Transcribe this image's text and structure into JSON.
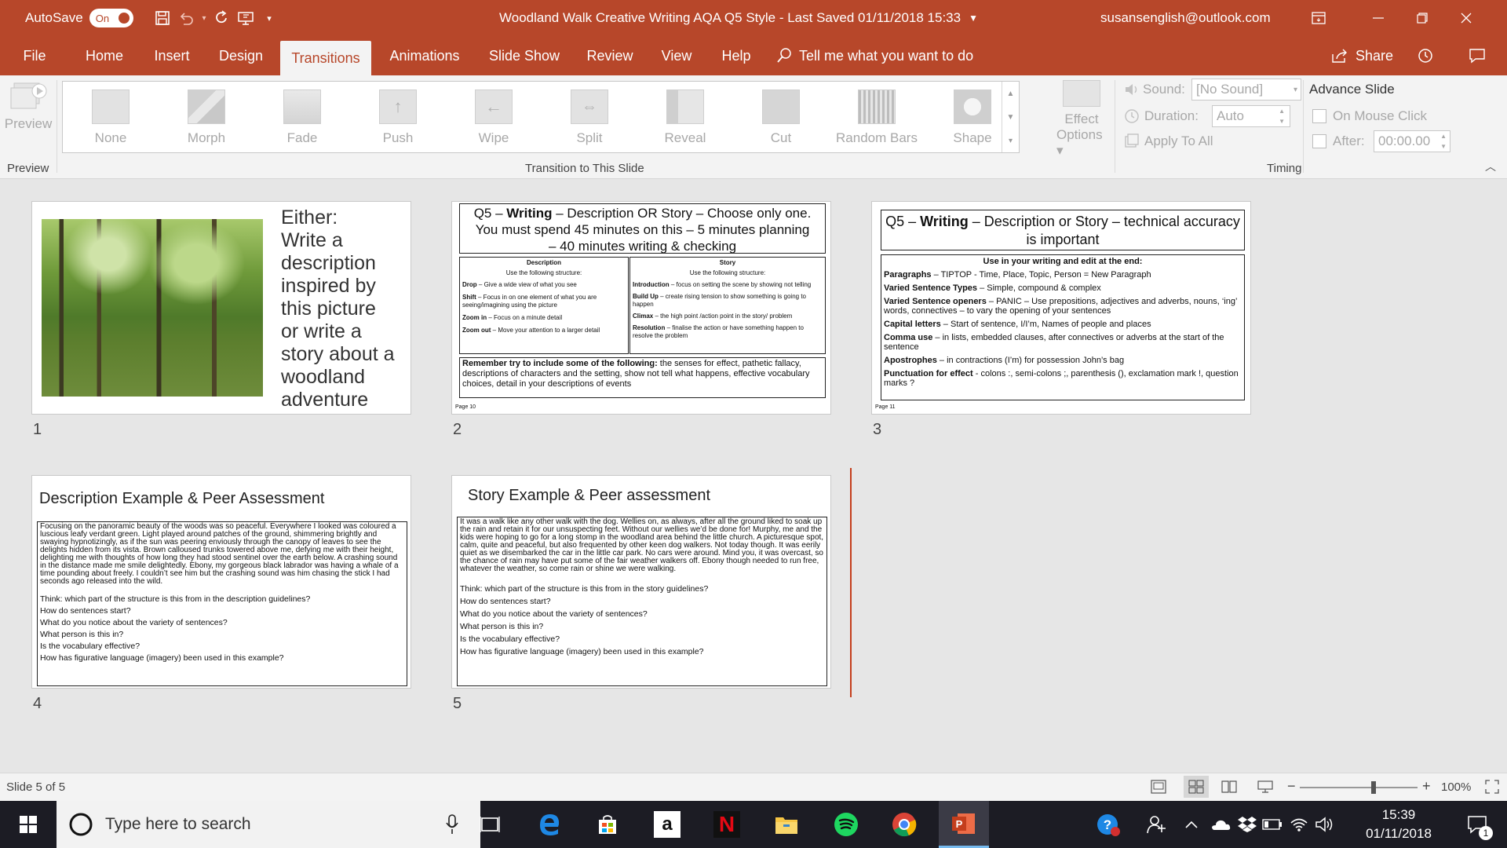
{
  "titlebar": {
    "autosave_label": "AutoSave",
    "autosave_state": "On",
    "document_title": "Woodland Walk Creative Writing AQA Q5 Style  -  Last Saved 01/11/2018 15:33",
    "account": "susansenglish@outlook.com"
  },
  "tabs": [
    {
      "label": "File"
    },
    {
      "label": "Home"
    },
    {
      "label": "Insert"
    },
    {
      "label": "Design"
    },
    {
      "label": "Transitions",
      "active": true
    },
    {
      "label": "Animations"
    },
    {
      "label": "Slide Show"
    },
    {
      "label": "Review"
    },
    {
      "label": "View"
    },
    {
      "label": "Help"
    }
  ],
  "tell_me": "Tell me what you want to do",
  "share_label": "Share",
  "ribbon": {
    "preview_label": "Preview",
    "preview_group": "Preview",
    "transitions": [
      "None",
      "Morph",
      "Fade",
      "Push",
      "Wipe",
      "Split",
      "Reveal",
      "Cut",
      "Random Bars",
      "Shape"
    ],
    "effect_options_line1": "Effect",
    "effect_options_line2": "Options",
    "transition_group": "Transition to This Slide",
    "sound_label": "Sound:",
    "sound_value": "[No Sound]",
    "duration_label": "Duration:",
    "duration_value": "Auto",
    "apply_all": "Apply To All",
    "advance_label": "Advance Slide",
    "on_mouse_click": "On Mouse Click",
    "after_label": "After:",
    "after_value": "00:00.00",
    "timing_group": "Timing"
  },
  "slides": {
    "s1": {
      "number": "1",
      "text_lines": [
        "Either:",
        "Write a",
        "description",
        "inspired by",
        "this picture",
        "or  write a",
        "story about a",
        "woodland",
        "adventure"
      ]
    },
    "s2": {
      "number": "2",
      "header_line1_prefix": "Q5 – ",
      "header_bold": "Writing",
      "header_line1_suffix": " – Description OR Story – Choose only one.",
      "header_line2": "You must spend 45 minutes on this – 5 minutes planning",
      "header_line3": "– 40 minutes writing & checking",
      "desc_title": "Description",
      "desc_sub": "Use the following structure:",
      "desc_items": [
        {
          "bold": "Drop",
          "text": " – Give a wide view of what you see"
        },
        {
          "bold": "Shift",
          "text": " – Focus in on one element of what you are seeing/imagining using the picture"
        },
        {
          "bold": "Zoom in",
          "text": " – Focus on a minute detail"
        },
        {
          "bold": "Zoom out",
          "text": " – Move your attention to a larger detail"
        }
      ],
      "story_title": "Story",
      "story_sub": "Use the following structure:",
      "story_items": [
        {
          "bold": "Introduction",
          "text": " – focus on setting the scene by showing not telling"
        },
        {
          "bold": "Build Up",
          "text": " – create rising tension to show something is going to happen"
        },
        {
          "bold": "Climax",
          "text": " – the high point /action point in the story/ problem"
        },
        {
          "bold": "Resolution",
          "text": " – finalise the action or have something happen to resolve the problem"
        }
      ],
      "remember_bold": "Remember try to include some of the following:",
      "remember_text": " the senses for effect, pathetic fallacy, descriptions of characters and the setting, show not tell what happens, effective vocabulary choices, detail in your descriptions of events",
      "page_label": "Page 10"
    },
    "s3": {
      "number": "3",
      "header_prefix": "Q5 – ",
      "header_bold": "Writing",
      "header_suffix": " – Description or Story – technical accuracy is important",
      "use_line": "Use in your writing and edit at the end:",
      "items": [
        {
          "bold": "Paragraphs",
          "text": " – TIPTOP - Time, Place, Topic, Person = New Paragraph"
        },
        {
          "bold": "Varied Sentence Types",
          "text": " – Simple, compound & complex"
        },
        {
          "bold": "Varied Sentence openers",
          "text": " – PANIC – Use prepositions, adjectives and adverbs, nouns, ‘ing’ words, connectives – to vary the opening of your sentences"
        },
        {
          "bold": "Capital letters",
          "text": " – Start of sentence, I/I’m, Names of people and places"
        },
        {
          "bold": "Comma use",
          "text": " – in lists, embedded clauses, after connectives or adverbs at the start of the sentence"
        },
        {
          "bold": "Apostrophes",
          "text": " – in contractions (I’m) for possession John’s bag"
        },
        {
          "bold": "Punctuation for effect",
          "text": " - colons :, semi-colons ;, parenthesis (), exclamation mark !, question marks ?"
        }
      ],
      "page_label": "Page 11"
    },
    "s4": {
      "number": "4",
      "title": "Description Example & Peer Assessment",
      "paragraph": "Focusing on the panoramic beauty of the woods was so peaceful. Everywhere I looked was coloured a luscious leafy verdant green. Light played around patches of the ground, shimmering brightly and swaying hypnotizingly, as if the sun was peering enviously through the canopy of leaves to see the delights hidden from its vista.  Brown calloused trunks towered above me, defying me with their height, delighting me with thoughts of how long they had stood sentinel over the earth below. A crashing sound in the distance made me smile delightedly. Ebony, my gorgeous black labrador was having a whale of a time pounding about freely. I couldn’t see him but the crashing sound was him chasing the stick I had seconds ago released into the wild.",
      "questions": [
        "Think: which part of the structure is this from in the description guidelines?",
        "How do sentences start?",
        "What do you notice about the variety of sentences?",
        "What person is this in?",
        "Is the vocabulary effective?",
        "How has figurative language (imagery) been used in this example?"
      ]
    },
    "s5": {
      "number": "5",
      "title": "Story Example & Peer assessment",
      "paragraph": "It was a walk like any other walk with the dog. Wellies on, as always, after all the ground liked to soak up the rain and retain it for our unsuspecting feet. Without our wellies we’d be done for! Murphy, me and the kids were hoping to go for a long stomp in the woodland area behind the little church. A picturesque spot, calm, quite and peaceful, but also frequented by other keen dog walkers. Not today though. It was eerily quiet as we disembarked the car in the little car park. No cars were around. Mind you, it was overcast, so the chance of rain may have put some of the fair weather walkers off. Ebony though needed to run free, whatever the weather, so come rain or shine we were walking.",
      "questions": [
        "Think: which part of the structure is this from in the story guidelines?",
        "How do sentences start?",
        "What do you notice about the variety of sentences?",
        "What person is this in?",
        "Is the vocabulary effective?",
        "How has figurative language (imagery) been used in this example?"
      ]
    }
  },
  "statusbar": {
    "slide_counter": "Slide 5 of 5",
    "zoom": "100%",
    "zoom_level": 1.0
  },
  "taskbar": {
    "search_placeholder": "Type here to search",
    "time": "15:39",
    "date": "01/11/2018",
    "notification_count": "1"
  },
  "colors": {
    "accent": "#b7472a",
    "insertion_marker": "#c43e1c",
    "taskbar": "#1c1c24"
  }
}
